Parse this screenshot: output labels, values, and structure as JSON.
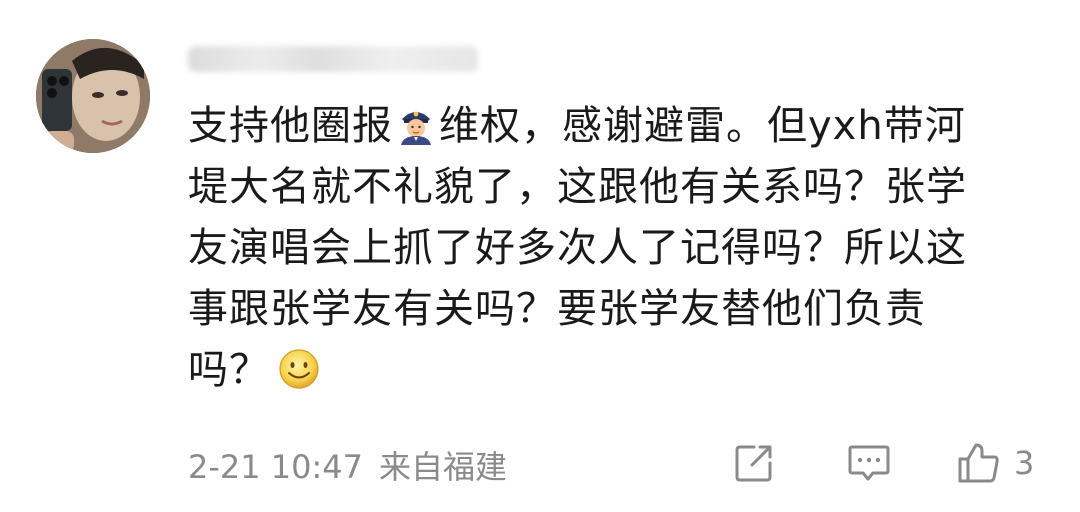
{
  "comment": {
    "username": "",
    "lines": [
      {
        "before": "支持他圈报",
        "emoji": "police-officer",
        "after": "维权，感谢避雷。但yxh带河"
      },
      {
        "text": "堤大名就不礼貌了，这跟他有关系吗？张学"
      },
      {
        "text": "友演唱会上抓了好多次人了记得吗？所以这"
      },
      {
        "text": "事跟张学友有关吗？要张学友替他们负责"
      },
      {
        "text": "吗？",
        "emoji": "smile"
      }
    ]
  },
  "footer": {
    "date": "2-21 10:47",
    "location": "来自福建",
    "like_count": "3"
  },
  "icons": {
    "share": "share-icon",
    "reply": "comment-icon",
    "like": "thumbs-up-icon"
  },
  "colors": {
    "text": "#1a1a1a",
    "meta": "#8a8a8a"
  }
}
